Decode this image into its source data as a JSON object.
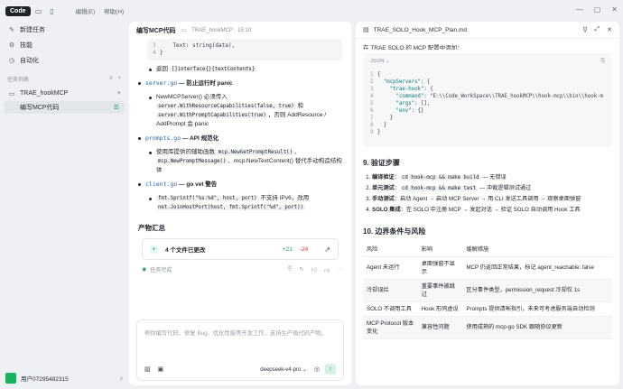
{
  "topbar": {
    "mode_label": "Code",
    "menu": [
      "编辑(E)",
      "帮助(H)"
    ]
  },
  "sidebar": {
    "items": [
      {
        "label": "新建任务",
        "icon": "new-task-icon"
      },
      {
        "label": "技能",
        "icon": "skills-icon"
      },
      {
        "label": "自动化",
        "icon": "automation-icon"
      }
    ],
    "section_label": "任务列表",
    "project": "TRAE_hookMCP",
    "active_task": "编写MCP代码",
    "user": "用户07295482315"
  },
  "chat": {
    "title": "编写MCP代码",
    "subtitle": "TRAE_hookMCP · 15:10",
    "code": [
      {
        "ln": "3",
        "text": "    Text: string(data),"
      },
      {
        "ln": "4",
        "text": "}"
      }
    ],
    "bullets": [
      {
        "pre": "返回 ",
        "code": "[]interface{}{textContents}",
        "post": ""
      },
      {
        "link": "server.go",
        "post": " — 防止运行时 panic"
      },
      {
        "pre": "NewMCPServer() 必须传入 ",
        "code": "server.WithResourceCapabilities(false, true)",
        "mid": " 和 ",
        "code2": "server.WithPromptCapabilities(true)",
        "post": "，否则 AddResource / AddPrompt 会 panic",
        "sub": true
      },
      {
        "link": "prompts.go",
        "post": " — API 规范化"
      },
      {
        "pre": "使用库提供的辅助函数 ",
        "code": "mcp.NewGetPromptResult()",
        "mid": "、",
        "code2": "mcp.NewPromptMessage()",
        "post": "、mcp.NewTextContent() 替代手动构造结构体",
        "sub": true
      },
      {
        "link": "client.go",
        "post": " — go vet 警告"
      },
      {
        "pre": "",
        "code": "fmt.Sprintf(\"%s:%d\", host, port)",
        "mid": " 不支持 IPv6，改用 ",
        "code2": "net.JoinHostPort(host, fmt.Sprintf(\"%d\", port))",
        "post": "",
        "sub": true
      }
    ],
    "products_heading": "产物汇总",
    "file_card": {
      "label": "4 个文件已更改",
      "added": "+21",
      "removed": "-24"
    },
    "status": "任务完成",
    "input_placeholder": "帮你编写代码、修复 Bug、优化性能等开发工作，支持生产级代码产物。",
    "model": "deepseek-v4-pro"
  },
  "doc": {
    "title": "TRAE_SOLO_Hook_MCP_Plan.md",
    "cut_line": "在 TRAE SOLO 的 MCP 配置中添加：",
    "json_label": "JSON",
    "json_lines": [
      {
        "ln": "1",
        "text": "{"
      },
      {
        "ln": "2",
        "text": "  \"mcpServers\": {"
      },
      {
        "ln": "3",
        "text": "    \"trae-hook\": {"
      },
      {
        "ln": "4",
        "text": "      \"command\": \"E:\\\\Code_WorkSpace\\\\TRAE_hookMCP\\\\hook-mcp\\\\bin\\\\hook-m"
      },
      {
        "ln": "5",
        "text": "      \"args\": [],"
      },
      {
        "ln": "6",
        "text": "      \"env\": {}"
      },
      {
        "ln": "7",
        "text": "    }"
      },
      {
        "ln": "8",
        "text": "  }"
      },
      {
        "ln": "9",
        "text": "}"
      }
    ],
    "section9": "9. 验证步骤",
    "steps": [
      {
        "bold": "编译验证",
        "code": "cd hook-mcp && make build",
        "post": " — 无错误"
      },
      {
        "bold": "单元测试",
        "code": "cd hook-mcp && make test",
        "post": " — 冲裁逻辑测试通过"
      },
      {
        "bold": "手动测试",
        "code": "",
        "post": "启动 Agent → 启动 MCP Server → 用 CLI 发送工具调用 → 观察桌面弹窗"
      },
      {
        "bold": "SOLO 集成",
        "code": "",
        "post": "在 SOLO 中注册 MCP → 发起对话 → 验证 SOLO 自动调用 Hook 工具"
      }
    ],
    "section10": "10. 边界条件与风险",
    "table_headers": [
      "风险",
      "影响",
      "缓解措施"
    ],
    "table_rows": [
      [
        "Agent 未运行",
        "桌面弹窗不显示",
        "MCP 仍返回正常结果，标记 agent_reachable: false"
      ],
      [
        "冷却误拦",
        "重要事件被跳过",
        "区分事件类型，permission_request 冷却仅 1s"
      ],
      [
        "SOLO 不调用工具",
        "Hook 形同虚设",
        "Prompts 提供清晰指引，未来可考虑服务端自动检测"
      ],
      [
        "MCP Protocol 版本变化",
        "兼容性问题",
        "使用成熟的 mcp-go SDK 跟随协议更新"
      ]
    ]
  }
}
